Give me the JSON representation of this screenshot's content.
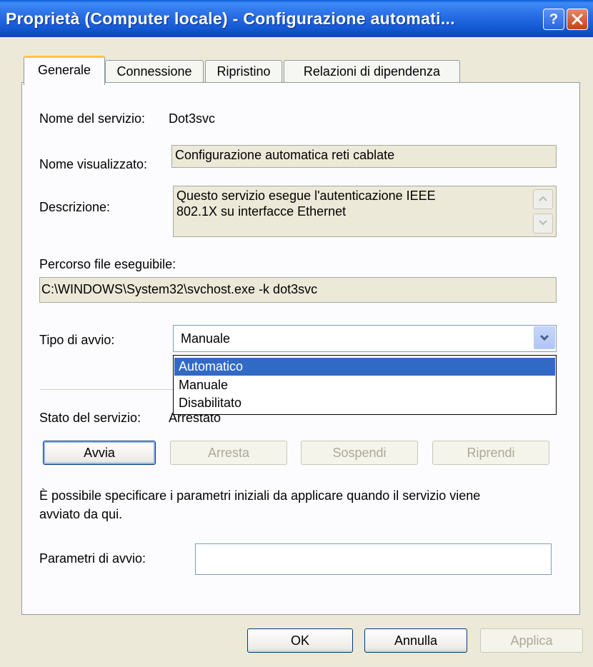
{
  "window": {
    "title": "Proprietà (Computer locale) - Configurazione automati...",
    "help_label": "?",
    "close_icon": "close-icon"
  },
  "tabs": [
    {
      "label": "Generale",
      "active": true
    },
    {
      "label": "Connessione",
      "active": false
    },
    {
      "label": "Ripristino",
      "active": false
    },
    {
      "label": "Relazioni di dipendenza",
      "active": false
    }
  ],
  "general": {
    "service_name_label": "Nome del servizio:",
    "service_name_value": "Dot3svc",
    "display_name_label": "Nome visualizzato:",
    "display_name_value": "Configurazione automatica reti cablate",
    "description_label": "Descrizione:",
    "description_line1": "Questo servizio esegue l'autenticazione IEEE",
    "description_line2": "802.1X su interfacce Ethernet",
    "exe_path_label": "Percorso file eseguibile:",
    "exe_path_value": "C:\\WINDOWS\\System32\\svchost.exe -k dot3svc",
    "startup_type_label": "Tipo di avvio:",
    "startup_type_value": "Manuale",
    "startup_options": [
      "Automatico",
      "Manuale",
      "Disabilitato"
    ],
    "highlighted_option": "Automatico",
    "status_label": "Stato del servizio:",
    "status_value": "Arrestato",
    "buttons": {
      "start": "Avvia",
      "stop": "Arresta",
      "pause": "Sospendi",
      "resume": "Riprendi"
    },
    "info_line1": "È possibile specificare i parametri iniziali da applicare quando il servizio viene",
    "info_line2": "avviato da qui.",
    "start_params_label": "Parametri di avvio:",
    "start_params_value": ""
  },
  "footer": {
    "ok": "OK",
    "cancel": "Annulla",
    "apply": "Applica"
  },
  "colors": {
    "title_bar": "#2a6fe6",
    "selection": "#316ac5",
    "active_tab_accent": "#ffc83c"
  }
}
